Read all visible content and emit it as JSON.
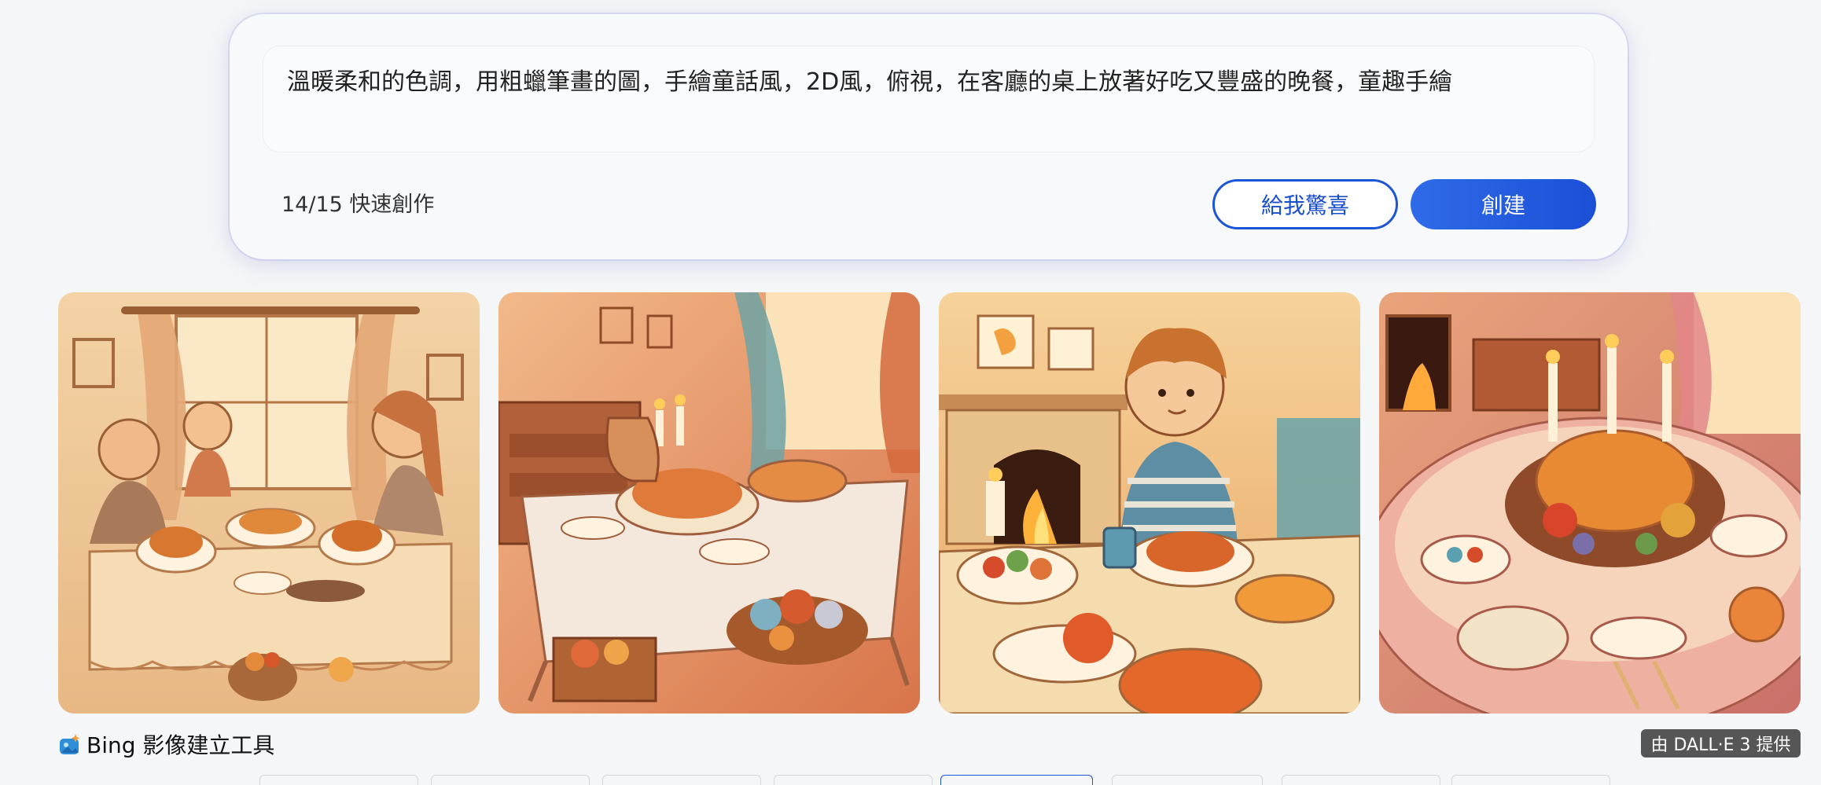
{
  "prompt": {
    "text": "溫暖柔和的色調，用粗蠟筆畫的圖，手繪童話風，2D風，俯視，在客廳的桌上放著好吃又豐盛的晚餐，童趣手繪"
  },
  "quota": {
    "label": "14/15 快速創作"
  },
  "buttons": {
    "surprise_label": "給我驚喜",
    "create_label": "創建"
  },
  "gallery": {
    "images": [
      {
        "subject": "family-dinner-crayon"
      },
      {
        "subject": "table-with-bread-crayon"
      },
      {
        "subject": "boy-at-dinner-crayon"
      },
      {
        "subject": "feast-table-crayon"
      }
    ]
  },
  "footer": {
    "brand_label": "Bing 影像建立工具",
    "dalle_badge": "由 DALL·E 3 提供"
  },
  "colors": {
    "accent": "#1d55d6",
    "badge_bg": "#565656"
  }
}
